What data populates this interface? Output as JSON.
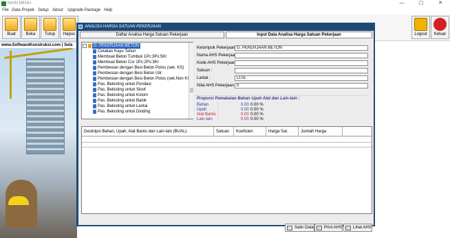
{
  "app": {
    "title": "MAIN MENU",
    "url": "www.SoftwareKonstruksi.com",
    "url_suffix": "| Sela"
  },
  "window_controls": {
    "minimize": "—",
    "restore": "▢",
    "close": "✕"
  },
  "menu": [
    "File",
    "Data Proyek",
    "Setup",
    "About",
    "Upgrade Package",
    "Help"
  ],
  "toolbar": {
    "buttons": [
      {
        "label": "Buat",
        "icon": "new-folder-icon"
      },
      {
        "label": "Buka",
        "icon": "open-folder-icon"
      },
      {
        "label": "Tutup",
        "icon": "close-folder-icon"
      },
      {
        "label": "Hapus",
        "icon": "delete-folder-icon"
      }
    ],
    "right_buttons": [
      {
        "label": "Logout",
        "icon": "key-icon"
      },
      {
        "label": "Keluar",
        "icon": "power-icon"
      }
    ]
  },
  "dialog": {
    "title": "ANALISA HARGA SATUAN PEKERJAAN",
    "tab_list": "Daftar Analisa Harga Satuan Pekerjaan",
    "tab_input": "Input Data Analisa Harga Satuan Pekerjaan",
    "tree": {
      "root": "G. PEKERJAAN BETON",
      "items": [
        "Cetakan Kayu Tahun",
        "Membuat Beton Tumbuk 1Pc:3Ps:5Kr",
        "Membuat Beton Cor 1Pc:2Ps:3Kr",
        "Pembesian dengan Besi Beton Polos (sek. KS)",
        "Pembesian dengan Besi Beton Ulir",
        "Pembesian dengan Besi Beton Polos (sek.Non KS)",
        "Pas. Bekisting untuk Pondasi",
        "Pas. Bekisting untuk Sloof",
        "Pas. Bekisting untuk Kolom",
        "Pas. Bekisting untuk Balok",
        "Pas. Bekisting untuk Lantai",
        "Pas. Bekisting untuk Dinding"
      ]
    },
    "form": {
      "kelompok_label": "Kelompok Pekerjaan :",
      "kelompok_value": "G. PEKERJAAN BETON",
      "nama_label": "Nama AHS Pekerjaan :",
      "nama_value": "",
      "kode_label": "Kode AHS Pekerjaan :",
      "kode_value": "",
      "satuan_label": "Satuan :",
      "satuan_value": "",
      "lantai_label": "Lantai :",
      "lantai_value": "Lt.01",
      "nilai_label": "Nilai AHS Pekerjaan :",
      "nilai_value": "0"
    },
    "proporsi": {
      "title": "Proporsi Pemakaian Bahan Upah Alat dan Lain-lain :",
      "rows": [
        {
          "label": "Bahan",
          "value": "0.00",
          "pct": "0.00 %",
          "color": "#1f3f9e"
        },
        {
          "label": "Upah",
          "value": "0.00",
          "pct": "0.00 %",
          "color": "#1f3f9e"
        },
        {
          "label": "Alat Bantu",
          "value": "0.00",
          "pct": "0.00 %",
          "color": "#c0202a"
        },
        {
          "label": "Lain-lain",
          "value": "0.00",
          "pct": "0.00 %",
          "color": "#7a2a9a"
        }
      ],
      "sep": ":"
    },
    "grid_columns": [
      "Deskripsi Bahan, Upah, Alat Bantu dan Lain-lain (BUAL)",
      "Satuan",
      "Koefisien",
      "Harga Sat.",
      "Jumlah Harga"
    ],
    "buttons": {
      "salin": "Salin Data",
      "print": "Print AHS",
      "lihat": "Lihat AHS"
    }
  }
}
